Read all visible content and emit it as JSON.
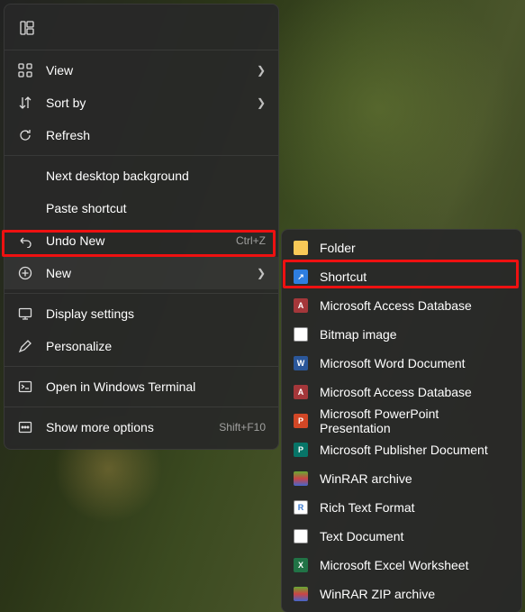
{
  "contextMenu": {
    "view": "View",
    "sortBy": "Sort by",
    "refresh": "Refresh",
    "nextBg": "Next desktop background",
    "pasteShortcut": "Paste shortcut",
    "undoNew": "Undo New",
    "undoAccel": "Ctrl+Z",
    "new": "New",
    "displaySettings": "Display settings",
    "personalize": "Personalize",
    "openTerminal": "Open in Windows Terminal",
    "showMore": "Show more options",
    "showMoreAccel": "Shift+F10"
  },
  "submenu": {
    "folder": "Folder",
    "shortcut": "Shortcut",
    "access": "Microsoft Access Database",
    "bitmap": "Bitmap image",
    "word": "Microsoft Word Document",
    "access2": "Microsoft Access Database",
    "ppt": "Microsoft PowerPoint Presentation",
    "pub": "Microsoft Publisher Document",
    "rar": "WinRAR archive",
    "rtf": "Rich Text Format",
    "txt": "Text Document",
    "excel": "Microsoft Excel Worksheet",
    "zip": "WinRAR ZIP archive"
  }
}
